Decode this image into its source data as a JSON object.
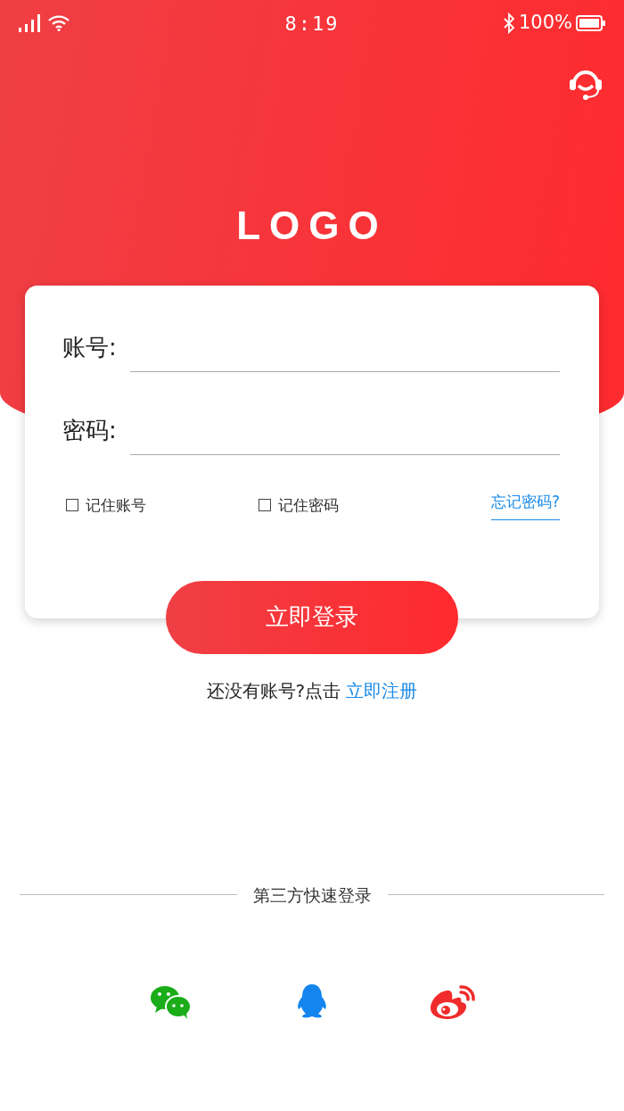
{
  "status_bar": {
    "time": "8:19",
    "battery": "100%"
  },
  "logo": "LOGO",
  "form": {
    "fields": [
      {
        "label": "账号:"
      },
      {
        "label": "密码:"
      }
    ],
    "options": [
      {
        "label": "记住账号",
        "checked": false
      },
      {
        "label": "记住密码",
        "checked": false
      }
    ],
    "forgot_link": "忘记密码?"
  },
  "login_button": "立即登录",
  "register": {
    "prompt": "还没有账号?点击",
    "link": "立即注册"
  },
  "third_party": {
    "title": "第三方快速登录",
    "providers": [
      {
        "kind": "wechat"
      },
      {
        "kind": "qq"
      },
      {
        "kind": "weibo"
      }
    ]
  }
}
